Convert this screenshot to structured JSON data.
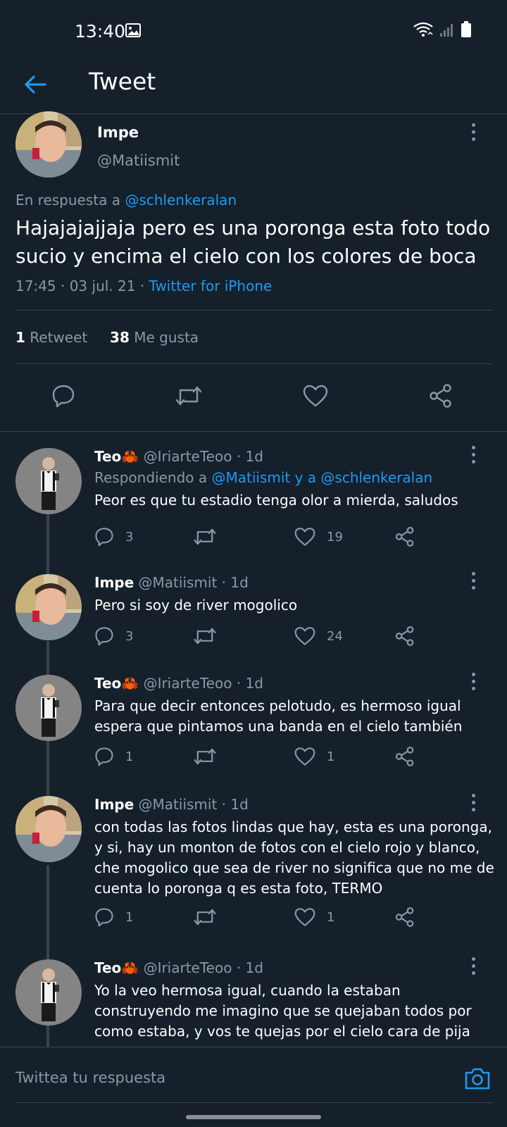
{
  "status_bar": {
    "time": "13:40",
    "icons": [
      "image-icon",
      "wifi-icon",
      "signal-icon",
      "battery-icon"
    ]
  },
  "app_bar": {
    "title": "Tweet",
    "back_icon": "arrow-left-icon"
  },
  "main_tweet": {
    "name": "Impe",
    "handle": "@Matiismit",
    "reply_prefix": "En respuesta a",
    "reply_to": "@schlenkeralan",
    "text": "Hajajajajjaja pero es una poronga esta foto todo sucio y encima el cielo con los colores de boca",
    "timestamp": "17:45 · 03 jul. 21 · ",
    "client": "Twitter for iPhone",
    "retweets_count": "1",
    "retweets_label": "Retweet",
    "likes_count": "38",
    "likes_label": "Me gusta"
  },
  "replies": [
    {
      "name": "Teo",
      "emoji": "🦀",
      "handle": "@IriarteTeoo",
      "time": "· 1d",
      "replying_prefix": "Respondiendo a",
      "replying_to": "@Matiismit y a @schlenkeralan",
      "text": "Peor es que tu estadio tenga olor a mierda, saludos",
      "reply_count": "3",
      "like_count": "19"
    },
    {
      "name": "Impe",
      "emoji": "",
      "handle": "@Matiismit",
      "time": "· 1d",
      "text": "Pero si soy de river mogolico",
      "reply_count": "3",
      "like_count": "24"
    },
    {
      "name": "Teo",
      "emoji": "🦀",
      "handle": "@IriarteTeoo",
      "time": "· 1d",
      "text": "Para que decir entonces pelotudo, es hermoso igual espera que pintamos una banda en el cielo también",
      "reply_count": "1",
      "like_count": "1"
    },
    {
      "name": "Impe",
      "emoji": "",
      "handle": "@Matiismit",
      "time": "· 1d",
      "text": "con todas las fotos lindas que hay, esta es una poronga, y si, hay un monton de fotos con el cielo rojo y blanco, che mogolico que sea de river no significa que no me de cuenta lo poronga q es esta foto, TERMO",
      "reply_count": "1",
      "like_count": "1"
    },
    {
      "name": "Teo",
      "emoji": "🦀",
      "handle": "@IriarteTeoo",
      "time": "· 1d",
      "text": "Yo la veo hermosa igual, cuando la estaban construyendo me imagino que se quejaban todos por como estaba, y vos te quejas por el cielo cara de pija"
    }
  ],
  "compose": {
    "placeholder": "Twittea tu respuesta",
    "camera_icon": "camera-icon"
  },
  "colors": {
    "background": "#15202b",
    "accent": "#1d9bf0",
    "muted": "#8899a6",
    "border": "#38444d"
  }
}
